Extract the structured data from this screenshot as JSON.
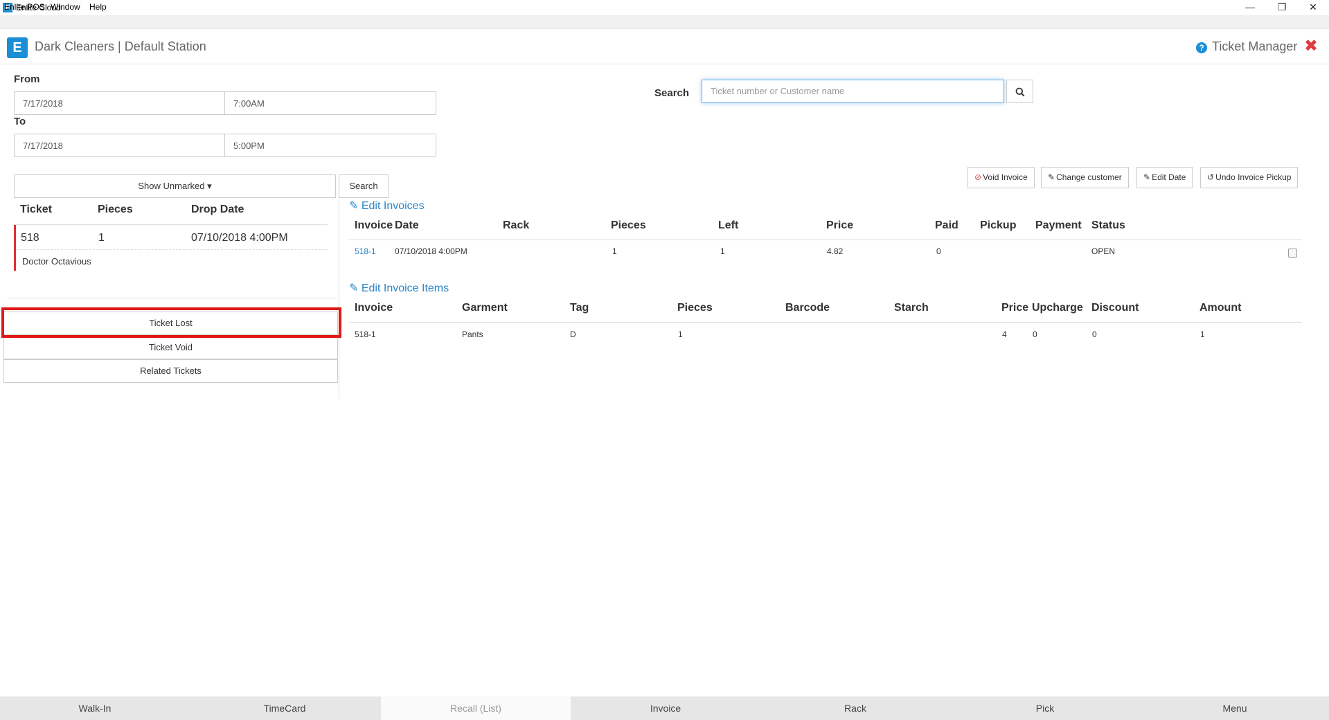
{
  "window": {
    "title": "Enlite Cloud",
    "logo_letter": "E",
    "controls": [
      "—",
      "❐",
      "✕"
    ]
  },
  "menu": [
    "Enlite POS",
    "Window",
    "Help"
  ],
  "header": {
    "title": "Dark Cleaners | Default Station",
    "manager": "Ticket Manager",
    "help_glyph": "?",
    "close_glyph": "✖"
  },
  "range": {
    "from_label": "From",
    "from_date": "7/17/2018",
    "from_time": "7:00AM",
    "to_label": "To",
    "to_date": "7/17/2018",
    "to_time": "5:00PM"
  },
  "search": {
    "label": "Search",
    "placeholder": "Ticket number or Customer name",
    "icon": "search-icon"
  },
  "left": {
    "filter_label": "Show Unmarked ▾",
    "search_button": "Search",
    "headers": [
      "Ticket",
      "Pieces",
      "Drop Date"
    ],
    "ticket": {
      "number": "518",
      "pieces": "1",
      "drop_date": "07/10/2018 4:00PM",
      "customer": "Doctor Octavious"
    },
    "actions": [
      "Ticket Lost",
      "Ticket Void",
      "Related Tickets"
    ],
    "accent": "#e03030"
  },
  "toolbar": {
    "void": "Void Invoice",
    "change_customer": "Change customer",
    "edit_date": "Edit Date",
    "undo_pickup": "Undo Invoice Pickup"
  },
  "invoices": {
    "title": "Edit Invoices",
    "headers": [
      "Invoice",
      "Date",
      "Rack",
      "Pieces",
      "Left",
      "Price",
      "Paid",
      "Pickup",
      "Payment",
      "Status"
    ],
    "rows": [
      {
        "invoice": "518-1",
        "date": "07/10/2018 4:00PM",
        "rack": "",
        "pieces": "1",
        "left": "1",
        "price": "4.82",
        "paid": "0",
        "pickup": "",
        "payment": "",
        "status": "OPEN"
      }
    ]
  },
  "items": {
    "title": "Edit Invoice Items",
    "headers": [
      "Invoice",
      "Garment",
      "Tag",
      "Pieces",
      "Barcode",
      "Starch",
      "Price",
      "Upcharge",
      "Discount",
      "Amount"
    ],
    "rows": [
      {
        "invoice": "518-1",
        "garment": "Pants",
        "tag": "D",
        "pieces": "1",
        "barcode": "",
        "starch": "",
        "price": "4",
        "upcharge": "0",
        "discount": "0",
        "amount": "1"
      }
    ]
  },
  "bottom_tabs": [
    "Walk-In",
    "TimeCard",
    "Recall (List)",
    "Invoice",
    "Rack",
    "Pick",
    "Menu"
  ],
  "active_tab": "Recall (List)",
  "colors": {
    "brand": "#1b8fd6",
    "link": "#2a86c9",
    "highlight": "#e01818",
    "close": "#e0393e"
  }
}
